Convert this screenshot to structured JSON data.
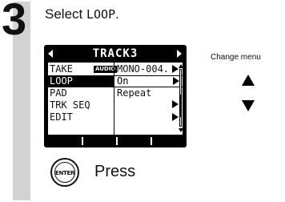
{
  "step": {
    "number": "3"
  },
  "instruction": {
    "prefix": "Select ",
    "code": "LOOP",
    "suffix": "."
  },
  "screen": {
    "title": "TRACK3",
    "rows": [
      {
        "label": "TAKE",
        "badge": "AUDIO",
        "value": "MONO-004."
      },
      {
        "label": "LOOP",
        "value": "On",
        "selected": true
      },
      {
        "label": "PAD",
        "value": "Repeat"
      },
      {
        "label": "TRK SEQ",
        "value": ""
      },
      {
        "label": "EDIT",
        "value": ""
      }
    ]
  },
  "side": {
    "label": "Change menu"
  },
  "enter": {
    "label": "ENTER",
    "caption": "Press"
  }
}
